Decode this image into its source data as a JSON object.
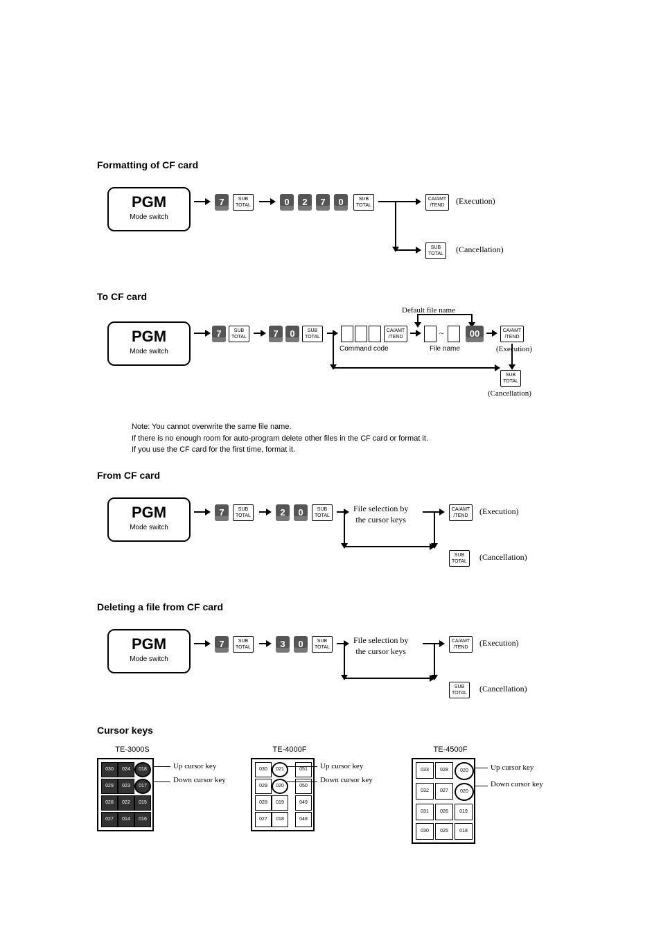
{
  "sections": {
    "format": {
      "title": "Formatting of CF card",
      "pgm": "PGM",
      "mode": "Mode switch",
      "d1": "7",
      "sub": "SUB\nTOTAL",
      "code": [
        "0",
        "2",
        "7",
        "0"
      ],
      "ca": "CA/AMT\n/TEND",
      "exec": "(Execution)",
      "cancel": "(Cancellation)"
    },
    "to": {
      "title": "To CF card",
      "d1": "7",
      "code": [
        "7",
        "0"
      ],
      "cmdlabel": "Command code",
      "filelabel": "File name",
      "defaultlabel": "Default file name",
      "tilde": "~",
      "zz": "00"
    },
    "from": {
      "title": "From CF card",
      "code": [
        "2",
        "0"
      ],
      "filesel": "File selection by\nthe  cursor keys"
    },
    "del": {
      "title": "Deleting a file from CF card",
      "code": [
        "3",
        "0"
      ]
    },
    "note": "Note:  You cannot overwrite the same file name.\nIf there is no enough room for auto-program delete other files in the CF card or format it.\nIf you use the CF card for the first time, format it.",
    "cursor": {
      "title": "Cursor keys",
      "up": "Up cursor key",
      "down": "Down cursor key",
      "models": {
        "m1": "TE-3000S",
        "m2": "TE-4000F",
        "m3": "TE-4500F"
      },
      "kb1": [
        [
          "030",
          "024",
          "018"
        ],
        [
          "029",
          "023",
          "017"
        ],
        [
          "028",
          "022",
          "015"
        ],
        [
          "027",
          "014",
          "016"
        ]
      ],
      "kb2": [
        [
          "030",
          "021",
          "",
          "051"
        ],
        [
          "029",
          "020",
          "",
          "050"
        ],
        [
          "028",
          "019",
          "",
          "049"
        ],
        [
          "027",
          "018",
          "",
          "048"
        ]
      ],
      "kb3": [
        [
          "033",
          "028",
          "020"
        ],
        [
          "032",
          "027",
          "020"
        ],
        [
          "031",
          "026",
          "019"
        ],
        [
          "030",
          "025",
          "018"
        ]
      ]
    }
  }
}
